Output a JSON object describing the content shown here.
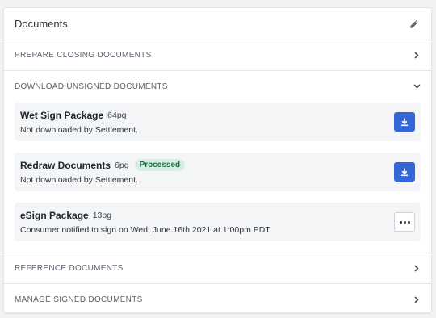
{
  "header": {
    "title": "Documents",
    "edit_icon": "pencil-icon"
  },
  "sections": {
    "prepare": {
      "label": "PREPARE CLOSING DOCUMENTS",
      "state": "collapsed"
    },
    "download": {
      "label": "DOWNLOAD UNSIGNED DOCUMENTS",
      "state": "expanded",
      "documents": [
        {
          "name": "Wet Sign Package",
          "pages": "64pg",
          "status": "Not downloaded by Settlement.",
          "badge": "",
          "action_icon": "download-icon"
        },
        {
          "name": "Redraw Documents",
          "pages": "6pg",
          "status": "Not downloaded by Settlement.",
          "badge": "Processed",
          "action_icon": "download-icon"
        },
        {
          "name": "eSign Package",
          "pages": "13pg",
          "status": "Consumer notified to sign on Wed, June 16th 2021 at 1:00pm PDT",
          "badge": "",
          "action_icon": "more-icon"
        }
      ]
    },
    "reference": {
      "label": "REFERENCE DOCUMENTS",
      "state": "collapsed"
    },
    "signed": {
      "label": "MANAGE SIGNED DOCUMENTS",
      "state": "collapsed"
    }
  },
  "colors": {
    "primary_button": "#3366d6",
    "badge_bg": "#d7efe3",
    "badge_text": "#1f6d48",
    "doc_row_bg": "#f4f5f7"
  }
}
